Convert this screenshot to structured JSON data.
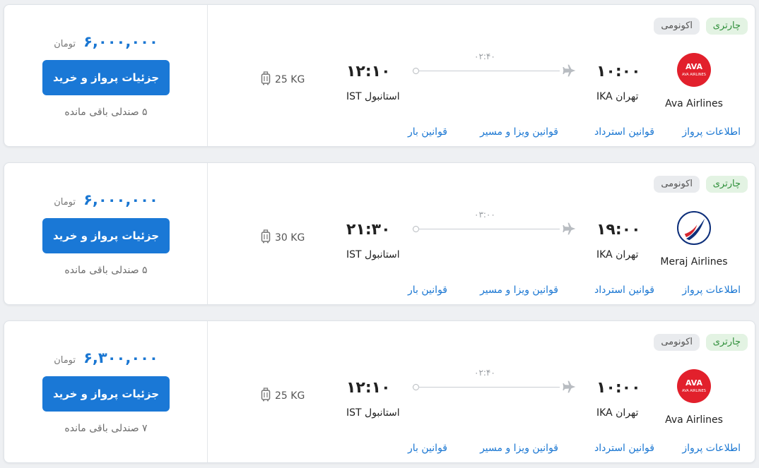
{
  "currency_label": "تومان",
  "buy_button_label": "جزئیات پرواز و خرید",
  "charter_label": "چارتری",
  "class_label": "اکونومی",
  "links": {
    "info": "اطلاعات پرواز",
    "refund": "قوانین استرداد",
    "visa": "قوانین ویزا و مسیر",
    "baggage": "قوانین بار"
  },
  "flights": [
    {
      "airline": "Ava Airlines",
      "dep_time": "۱۰:۰۰",
      "dep_city": "تهران IKA",
      "arr_time": "۱۲:۱۰",
      "arr_city": "استانبول IST",
      "duration": "۰۲:۴۰",
      "baggage": "25 KG",
      "price": "۶,۰۰۰,۰۰۰",
      "seats": "۵ صندلی باقی مانده"
    },
    {
      "airline": "Meraj Airlines",
      "dep_time": "۱۹:۰۰",
      "dep_city": "تهران IKA",
      "arr_time": "۲۱:۳۰",
      "arr_city": "استانبول IST",
      "duration": "۰۳:۰۰",
      "baggage": "30 KG",
      "price": "۶,۰۰۰,۰۰۰",
      "seats": "۵ صندلی باقی مانده"
    },
    {
      "airline": "Ava Airlines",
      "dep_time": "۱۰:۰۰",
      "dep_city": "تهران IKA",
      "arr_time": "۱۲:۱۰",
      "arr_city": "استانبول IST",
      "duration": "۰۲:۴۰",
      "baggage": "25 KG",
      "price": "۶,۳۰۰,۰۰۰",
      "seats": "۷ صندلی باقی مانده"
    }
  ],
  "colors": {
    "accent": "#1a78d6",
    "charter_bg": "#e3f3e3",
    "charter_text": "#2f8f3a",
    "ava_brand": "#e2202c",
    "meraj_brand": "#0d2f7a"
  },
  "logo_texts": {
    "ava": "AVA AIRLINES"
  }
}
